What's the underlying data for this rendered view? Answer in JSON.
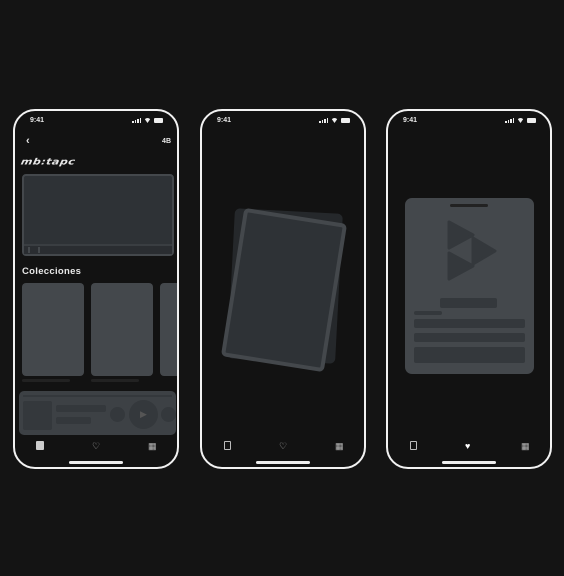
{
  "status": {
    "time": "9:41"
  },
  "screen1": {
    "back_icon": "chevron-left-icon",
    "badge": "4B",
    "logo": "mb:tapc",
    "section_title": "Colecciones"
  },
  "nav": {
    "icons": [
      "cards-icon",
      "heart-icon",
      "grid-icon"
    ]
  },
  "colors": {
    "background": "#141414",
    "placeholder": "#44484c",
    "frame": "#f2f2f2"
  }
}
